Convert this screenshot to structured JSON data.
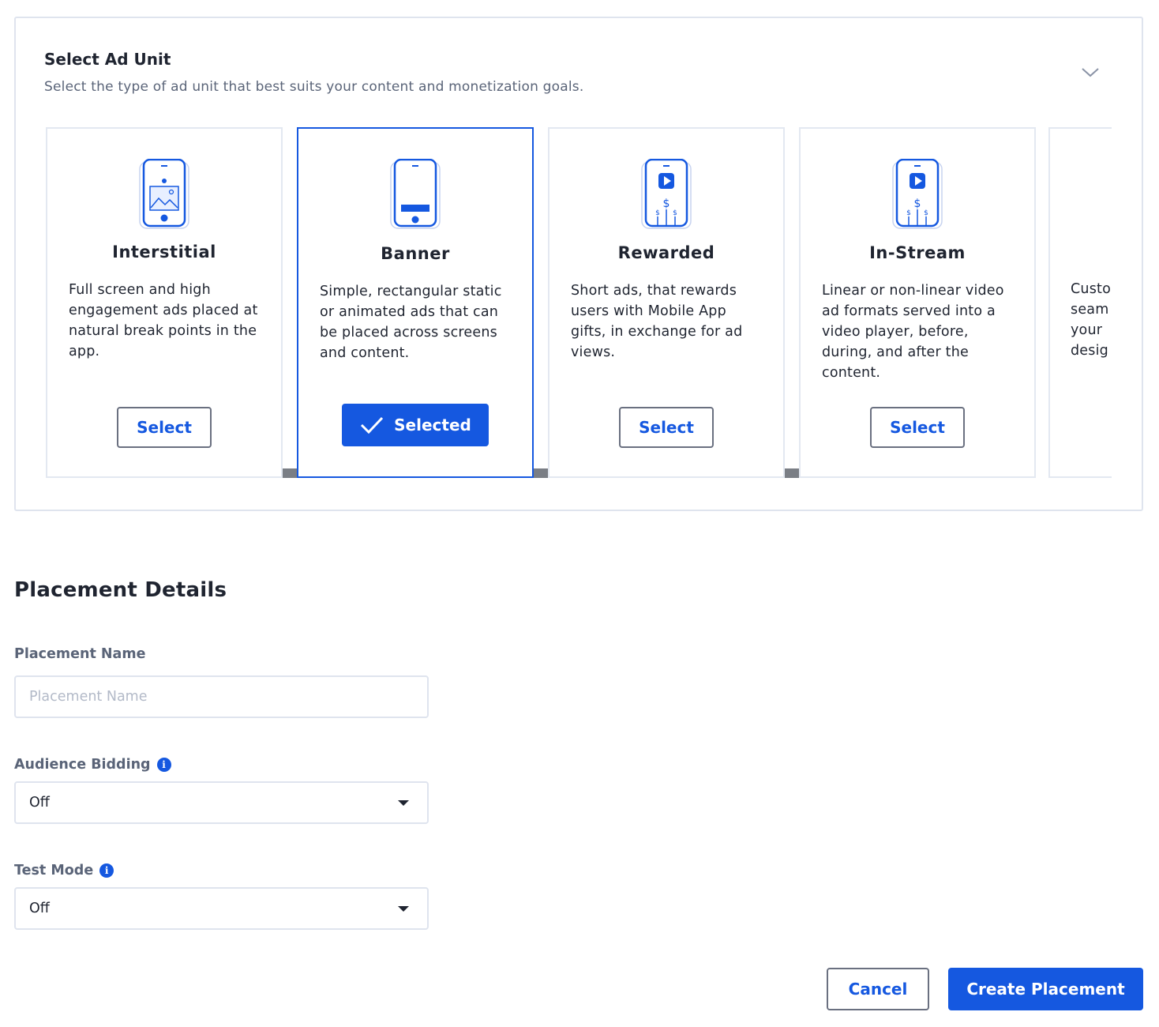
{
  "ad_unit_panel": {
    "title": "Select Ad Unit",
    "subtitle": "Select the type of ad unit that best suits your content and monetization goals.",
    "cards": [
      {
        "name": "Interstitial",
        "description": "Full screen and high engagement ads placed at natural break points in the app.",
        "button_label": "Select",
        "icon": "phone-image-icon",
        "selected": false
      },
      {
        "name": "Banner",
        "description": "Simple, rectangular static or animated ads that can be placed across screens and content.",
        "button_label": "Selected",
        "icon": "phone-banner-icon",
        "selected": true
      },
      {
        "name": "Rewarded",
        "description": "Short ads, that rewards users with Mobile App gifts, in exchange for ad views.",
        "button_label": "Select",
        "icon": "phone-play-dollar-icon",
        "selected": false
      },
      {
        "name": "In-Stream",
        "description": "Linear or non-linear video ad formats served into a video player, before, during, and after the content.",
        "button_label": "Select",
        "icon": "phone-play-dollar-icon",
        "selected": false
      }
    ],
    "partial_card_description": "Custo\nseam\nyour \ndesig"
  },
  "placement_details": {
    "title": "Placement Details",
    "placement_name": {
      "label": "Placement Name",
      "placeholder": "Placement Name",
      "value": ""
    },
    "audience_bidding": {
      "label": "Audience Bidding",
      "value": "Off"
    },
    "test_mode": {
      "label": "Test Mode",
      "value": "Off"
    }
  },
  "actions": {
    "cancel": "Cancel",
    "create": "Create Placement"
  },
  "colors": {
    "accent": "#1558e0",
    "border": "#dfe4ee",
    "muted_text": "#5a6478"
  }
}
